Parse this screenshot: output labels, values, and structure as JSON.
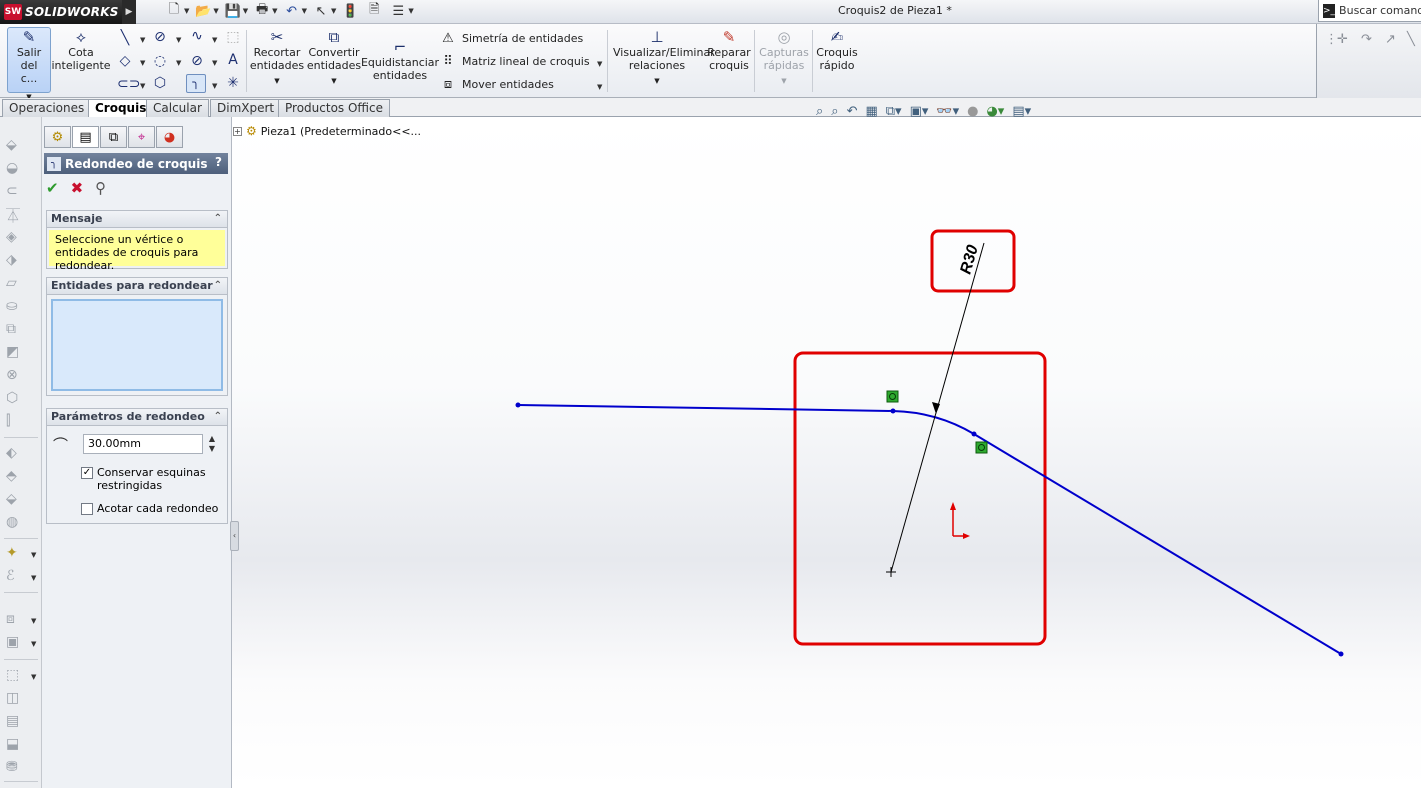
{
  "titlebar": {
    "app_name": "SOLIDWORKS",
    "app_badge": "SW",
    "document_title": "Croquis2 de Pieza1 *",
    "search_placeholder": "Buscar comandos",
    "quick_access_icons": [
      "new-icon",
      "open-icon",
      "save-icon",
      "print-icon",
      "undo-icon",
      "select-icon",
      "rebuild-icon",
      "options-icon",
      "file-properties-icon"
    ]
  },
  "command_manager": {
    "exit_sketch": "Salir del c...",
    "smart_dimension": "Cota inteligente",
    "trim": "Recortar entidades",
    "convert": "Convertir entidades",
    "offset": "Equidistanciar entidades",
    "mirror": "Simetría de entidades",
    "linear_pattern": "Matriz lineal de croquis",
    "move": "Mover entidades",
    "relations": "Visualizar/Eliminar relaciones",
    "repair": "Reparar croquis",
    "quick_snaps": "Capturas rápidas",
    "rapid_sketch": "Croquis rápido"
  },
  "tabs": [
    "Operaciones",
    "Croquis",
    "Calcular",
    "DimXpert",
    "Productos Office"
  ],
  "active_tab": "Croquis",
  "property_manager": {
    "title": "Redondeo de croquis",
    "help": "?",
    "message_header": "Mensaje",
    "message_text": "Seleccione un vértice o entidades de croquis para redondear.",
    "entities_header": "Entidades para redondear",
    "params_header": "Parámetros de redondeo",
    "radius_value": "30.00mm",
    "keep_constrained_label": "Conservar esquinas restringidas",
    "keep_constrained_checked": true,
    "dimension_each_label": "Acotar cada redondeo",
    "dimension_each_checked": false
  },
  "feature_tree": {
    "root": "Pieza1  (Predeterminado<<..."
  },
  "sketch": {
    "dimension_label": "R30",
    "sketch_color": "#0000cc",
    "highlight_color": "#e00000"
  }
}
